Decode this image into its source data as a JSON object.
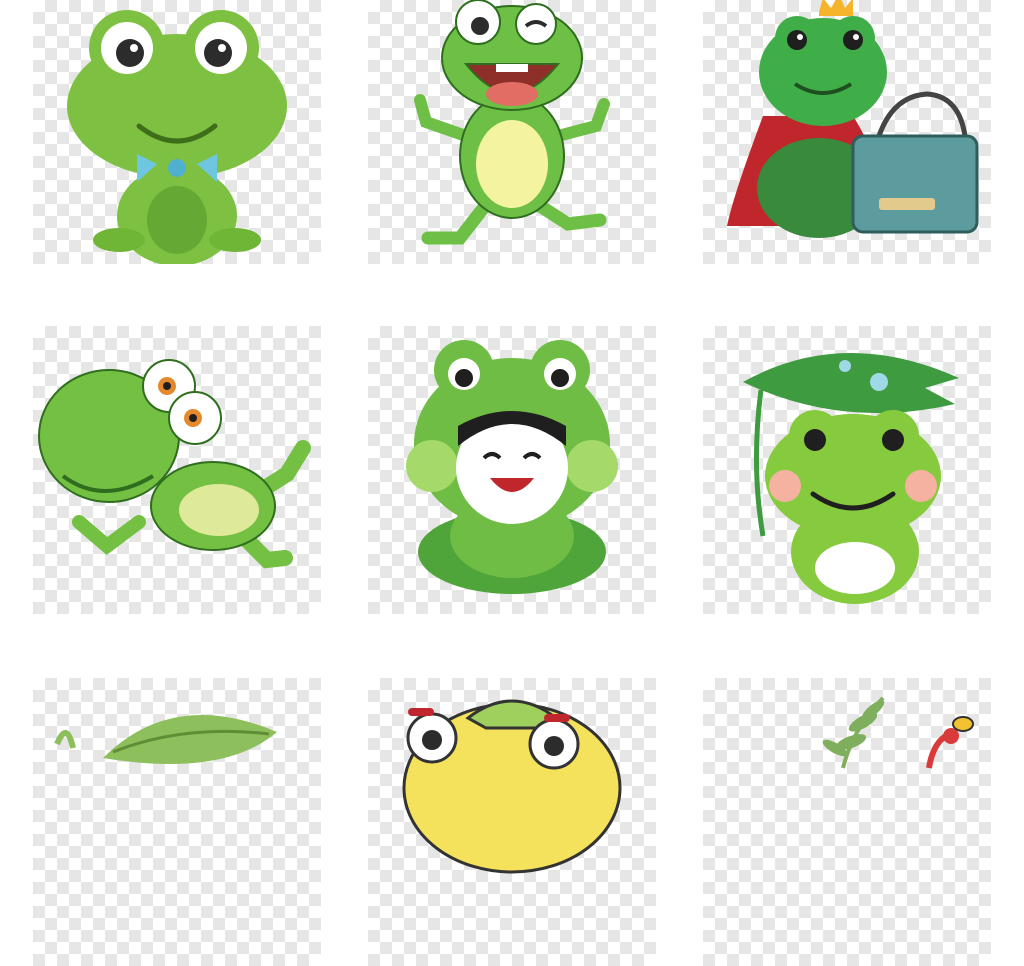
{
  "gallery": {
    "items": [
      {
        "name": "frog-with-bowtie",
        "colors": {
          "body": "#7ec142",
          "bowtie": "#6ec6e0"
        }
      },
      {
        "name": "waving-frog-laughing",
        "colors": {
          "body": "#6dbf45",
          "belly": "#f3f3a0"
        }
      },
      {
        "name": "prince-frog-with-crown-and-bag",
        "colors": {
          "body": "#3fae48",
          "cape": "#c0272d",
          "bag": "#5c9c9e",
          "crown": "#f6b42c"
        }
      },
      {
        "name": "jumping-frog",
        "colors": {
          "body": "#74c043",
          "belly": "#dfe99a",
          "eyes": "#e58a2c"
        }
      },
      {
        "name": "child-in-frog-costume",
        "colors": {
          "body": "#6fbd44",
          "leaf": "#4fa43a",
          "cheeks": "#a5d96a"
        }
      },
      {
        "name": "frog-with-lily-pad-umbrella",
        "colors": {
          "body": "#86ca3e",
          "leaf": "#3f9b3f",
          "cheeks": "#f5b2a0"
        }
      },
      {
        "name": "frog-under-leaf",
        "colors": {
          "leaf": "#8dbf5c"
        }
      },
      {
        "name": "cartoon-frog-face",
        "colors": {
          "body": "#f4e25c",
          "cap": "#9fcf5d"
        }
      },
      {
        "name": "fern-and-bee",
        "colors": {
          "fern": "#7fae5c",
          "flower": "#d93b3b",
          "bee": "#f1c232"
        }
      }
    ]
  }
}
